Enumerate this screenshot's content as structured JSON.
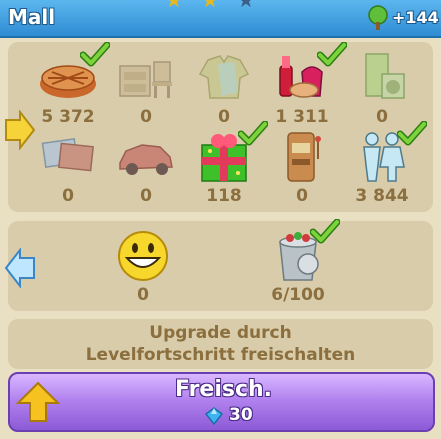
{
  "header": {
    "title": "Mall",
    "tree_count": "+144"
  },
  "row1": [
    {
      "name": "pie",
      "value": "5 372",
      "checked": true
    },
    {
      "name": "furniture",
      "value": "0",
      "checked": false
    },
    {
      "name": "clothes",
      "value": "0",
      "checked": false
    },
    {
      "name": "cosmetics",
      "value": "1 311",
      "checked": true
    },
    {
      "name": "appliances",
      "value": "0",
      "checked": false
    }
  ],
  "row2": [
    {
      "name": "magazines",
      "value": "0",
      "checked": false
    },
    {
      "name": "car",
      "value": "0",
      "checked": false
    },
    {
      "name": "gift",
      "value": "118",
      "checked": true
    },
    {
      "name": "slot-machine",
      "value": "0",
      "checked": false
    },
    {
      "name": "people",
      "value": "3 844",
      "checked": true
    }
  ],
  "row3": [
    {
      "name": "smiley",
      "value": "0",
      "checked": false
    },
    {
      "name": "trash-can",
      "value": "6/100",
      "checked": true
    }
  ],
  "upgrade": {
    "line1": "Upgrade durch",
    "line2": "Levelfortschritt freischalten"
  },
  "unlock_button": {
    "label": "Freisch.",
    "cost": "30"
  }
}
